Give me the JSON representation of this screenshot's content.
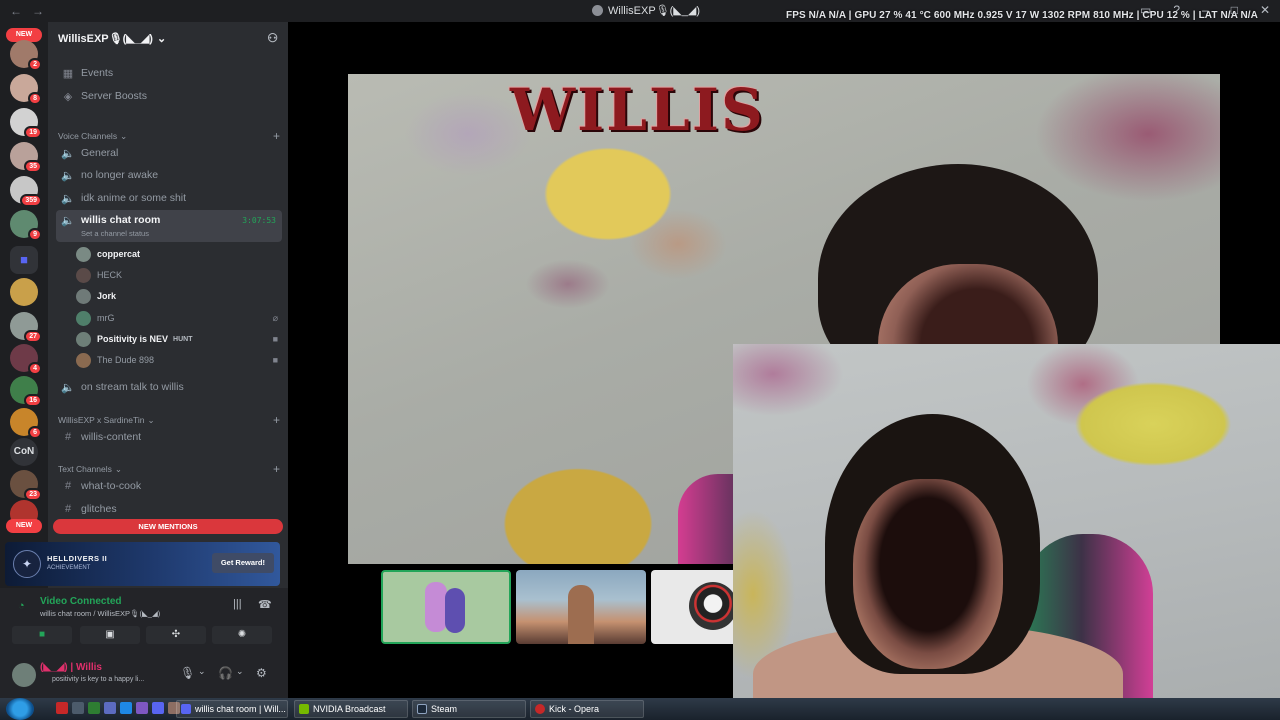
{
  "titlebar": {
    "title": "WillisEXP🎙(◣_◢)",
    "overlay": "FPS  N/A  N/A  |  GPU  27 %  41 °C  600 MHz  0.925 V  17 W  1302 RPM  810 MHz  |  CPU  12 %  |  LAT  N/A  N/A"
  },
  "rail": {
    "new_top": "NEW",
    "new_bottom": "NEW",
    "con": "CoN",
    "badges": [
      "2",
      "8",
      "19",
      "35",
      "359",
      "9",
      "27",
      "4",
      "16",
      "6",
      "23"
    ]
  },
  "server": {
    "name": "WillisEXP🎙(◣_◢)"
  },
  "sidebar": {
    "events": "Events",
    "boosts": "Server Boosts",
    "voice_category": "Voice Channels",
    "voice_channels": [
      "General",
      "no longer awake",
      "idk anime or some shit"
    ],
    "active_channel": "willis chat room",
    "active_timer": "3:07:53",
    "active_status": "Set a channel status",
    "users": [
      {
        "name": "coppercat",
        "bold": true
      },
      {
        "name": "HECK",
        "bold": false
      },
      {
        "name": "Jork",
        "bold": true
      },
      {
        "name": "mrG",
        "bold": false
      },
      {
        "name": "Positivity is NEV",
        "bold": true,
        "tag": "HUNT"
      },
      {
        "name": "The Dude 898",
        "bold": false
      }
    ],
    "stream_channel": "on stream talk to willis",
    "collab_category": "WillisEXP x SardineTin",
    "collab_channel": "willis-content",
    "text_category": "Text Channels",
    "text_channels": [
      "what-to-cook",
      "glitches"
    ],
    "new_mentions": "NEW MENTIONS"
  },
  "promo": {
    "game": "HELLDIVERS II",
    "sub": "ACHIEVEMENT",
    "button": "Get Reward!"
  },
  "voice": {
    "status": "Video Connected",
    "location": "willis chat room / WillisEXP🎙(◣_◢)"
  },
  "user": {
    "name": "(◣_◢) | Willis",
    "status": "positivity is key to a happy li..."
  },
  "stream": {
    "overlay_logo": "WILLIS"
  },
  "taskbar": {
    "tasks": [
      "willis chat room | Will...",
      "NVIDIA Broadcast",
      "Steam",
      "Kick - Opera"
    ]
  },
  "colors": {
    "accent_green": "#23a559",
    "alert_red": "#f23f43",
    "sidebar": "#2b2d31",
    "rail": "#1e1f22"
  }
}
